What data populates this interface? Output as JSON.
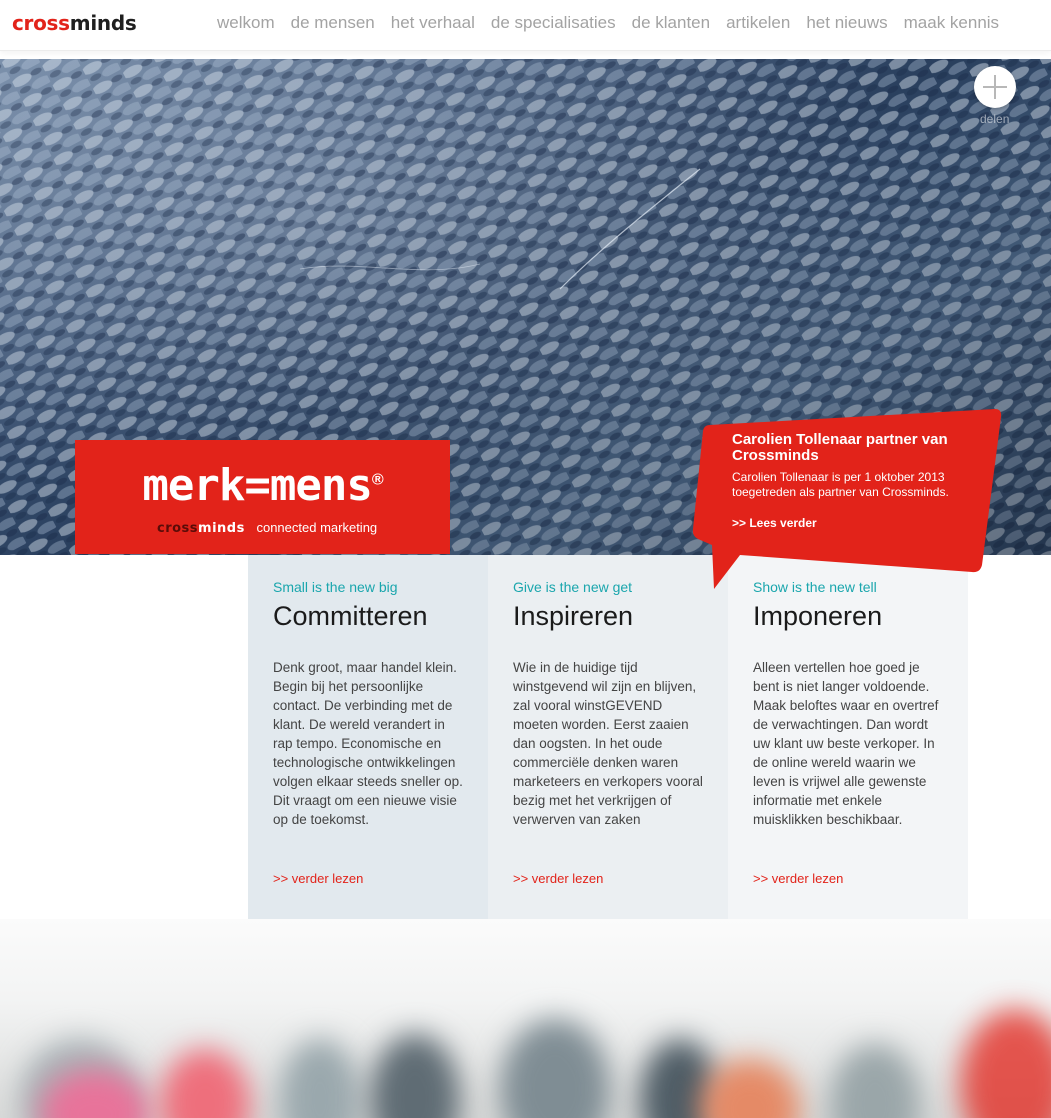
{
  "header": {
    "logo": {
      "part1": "cross",
      "part2": "minds"
    },
    "nav": [
      "welkom",
      "de mensen",
      "het verhaal",
      "de specialisaties",
      "de klanten",
      "artikelen",
      "het nieuws",
      "maak kennis"
    ]
  },
  "hero": {
    "plus_label": "delen",
    "brand": {
      "title": "merk=mens",
      "registered": "®",
      "sub_logo_part1": "cross",
      "sub_logo_part2": "minds",
      "tagline": "connected marketing"
    },
    "news": {
      "title": "Carolien Tollenaar partner van Crossminds",
      "body": "Carolien Tollenaar is per 1 oktober 2013 toegetreden als partner van Crossminds.",
      "link": ">> Lees verder"
    }
  },
  "columns": [
    {
      "tag": "Small is the new big",
      "heading": "Committeren",
      "body": "Denk groot, maar handel klein. Begin bij het persoonlijke contact. De verbinding met de klant. De wereld verandert in rap tempo. Economische en technologische ontwikkelingen volgen elkaar steeds sneller op. Dit vraagt om een nieuwe visie op de toekomst.",
      "link": ">> verder lezen"
    },
    {
      "tag": "Give is the new get",
      "heading": "Inspireren",
      "body": "Wie in de huidige tijd winstgevend wil zijn en blijven, zal vooral winstGEVEND moeten worden. Eerst zaaien dan oogsten. In het oude commerciële denken waren marketeers en verkopers vooral bezig met het verkrijgen of verwerven van zaken",
      "link": ">> verder lezen"
    },
    {
      "tag": "Show is the new tell",
      "heading": "Imponeren",
      "body": "Alleen vertellen hoe goed je bent is niet langer voldoende. Maak beloftes waar en overtref de verwachtingen. Dan wordt uw klant uw beste verkoper. In de online wereld waarin we leven is vrijwel alle gewenste informatie met enkele muisklikken beschikbaar.",
      "link": ">> verder lezen"
    }
  ],
  "colors": {
    "brand_red": "#e2231a",
    "accent_teal": "#1aa6ad",
    "nav_grey": "#a3a3a3"
  }
}
